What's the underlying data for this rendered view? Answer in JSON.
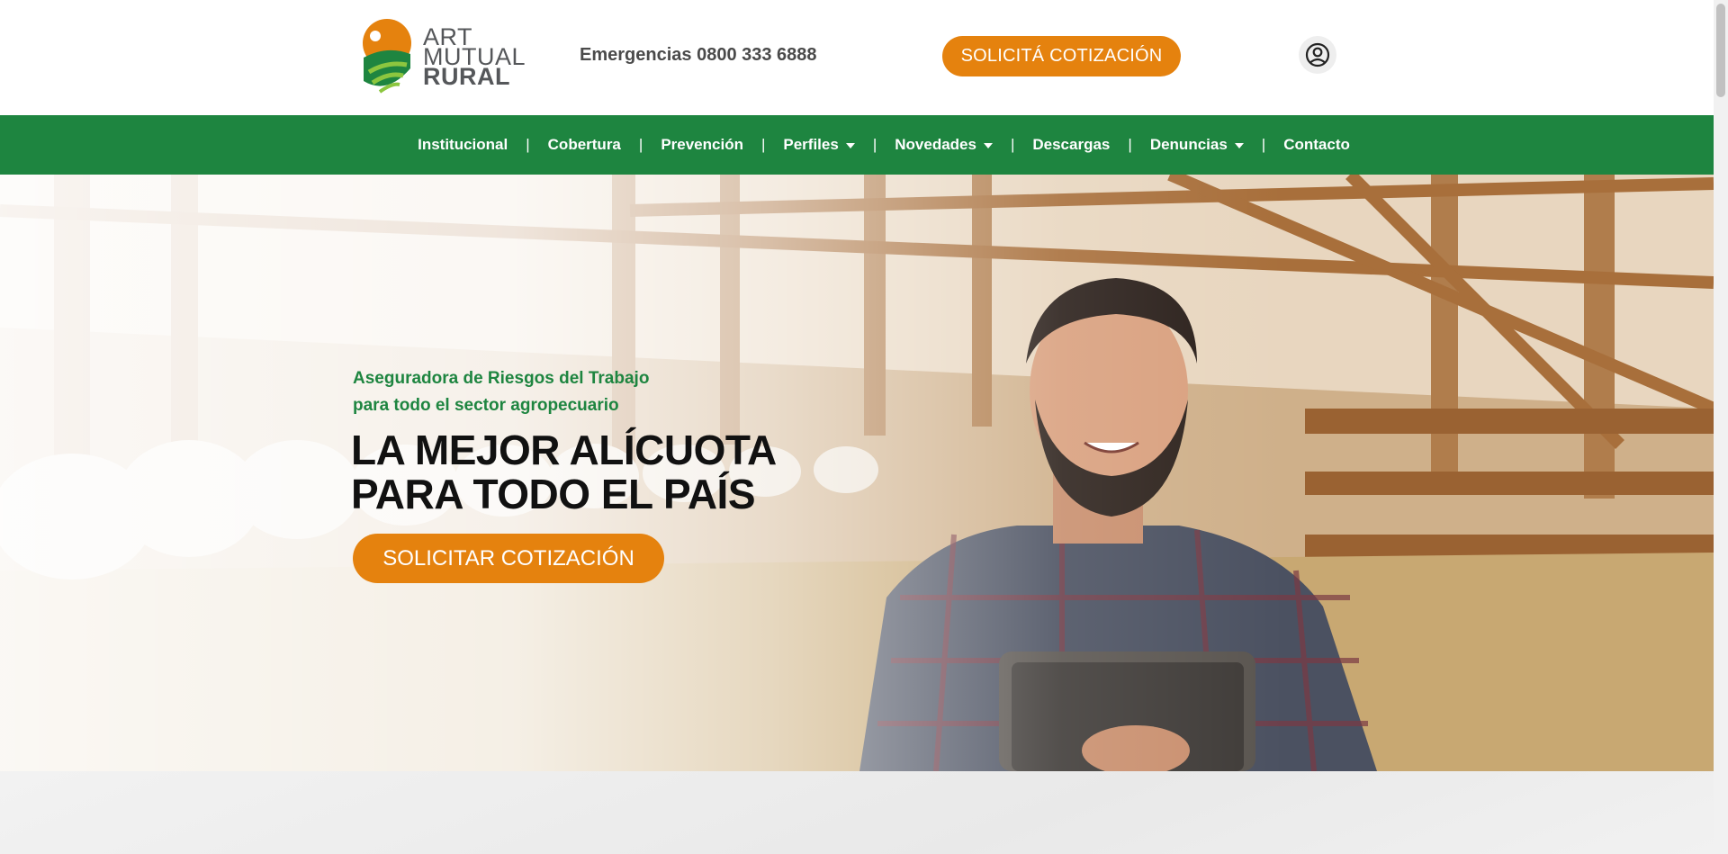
{
  "header": {
    "logo": {
      "line1": "ART",
      "line2": "MUTUAL",
      "line3": "RURAL"
    },
    "emergency_label": "Emergencias 0800 333 6888",
    "quote_button": "SOLICITÁ COTIZACIÓN",
    "user_icon": "user-circle-icon"
  },
  "nav": {
    "items": [
      {
        "label": "Institucional",
        "dropdown": false
      },
      {
        "label": "Cobertura",
        "dropdown": false
      },
      {
        "label": "Prevención",
        "dropdown": false
      },
      {
        "label": "Perfiles",
        "dropdown": true
      },
      {
        "label": "Novedades",
        "dropdown": true
      },
      {
        "label": "Descargas",
        "dropdown": false
      },
      {
        "label": "Denuncias",
        "dropdown": true
      },
      {
        "label": "Contacto",
        "dropdown": false
      }
    ],
    "separator": "|"
  },
  "hero": {
    "subtitle_line1": "Aseguradora de Riesgos del Trabajo",
    "subtitle_line2": "para todo el sector agropecuario",
    "title_line1": "LA MEJOR ALÍCUOTA",
    "title_line2": "PARA TODO EL PAÍS",
    "cta_button": "SOLICITAR COTIZACIÓN"
  },
  "colors": {
    "brand_green": "#1e8540",
    "brand_orange": "#e5820e",
    "text_dark": "#111111"
  }
}
